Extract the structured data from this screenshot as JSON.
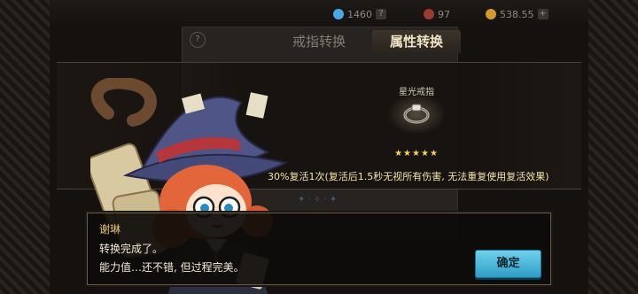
{
  "top_bar": {
    "gems": "1460",
    "gem_help": "?",
    "mid_value": "97",
    "gold": "538.55",
    "gold_add": "+"
  },
  "panel": {
    "help": "?",
    "tabs": [
      {
        "label": "戒指转换",
        "active": false
      },
      {
        "label": "属性转换",
        "active": true
      }
    ]
  },
  "item": {
    "name": "星光戒指",
    "stars": "★★★★★",
    "star_count": 5,
    "effect": "30%复活1次(复活后1.5秒无视所有伤害, 无法重复使用复活效果)"
  },
  "dialog": {
    "speaker": "谢琳",
    "line1": "转换完成了。",
    "line2": "能力值…还不错, 但过程完美。",
    "confirm": "确定"
  },
  "colors": {
    "accent_button": "#3fb6dc",
    "speaker_name": "#e8c87a",
    "stars": "#f6d24a",
    "effect_text": "#f2e3a8"
  }
}
